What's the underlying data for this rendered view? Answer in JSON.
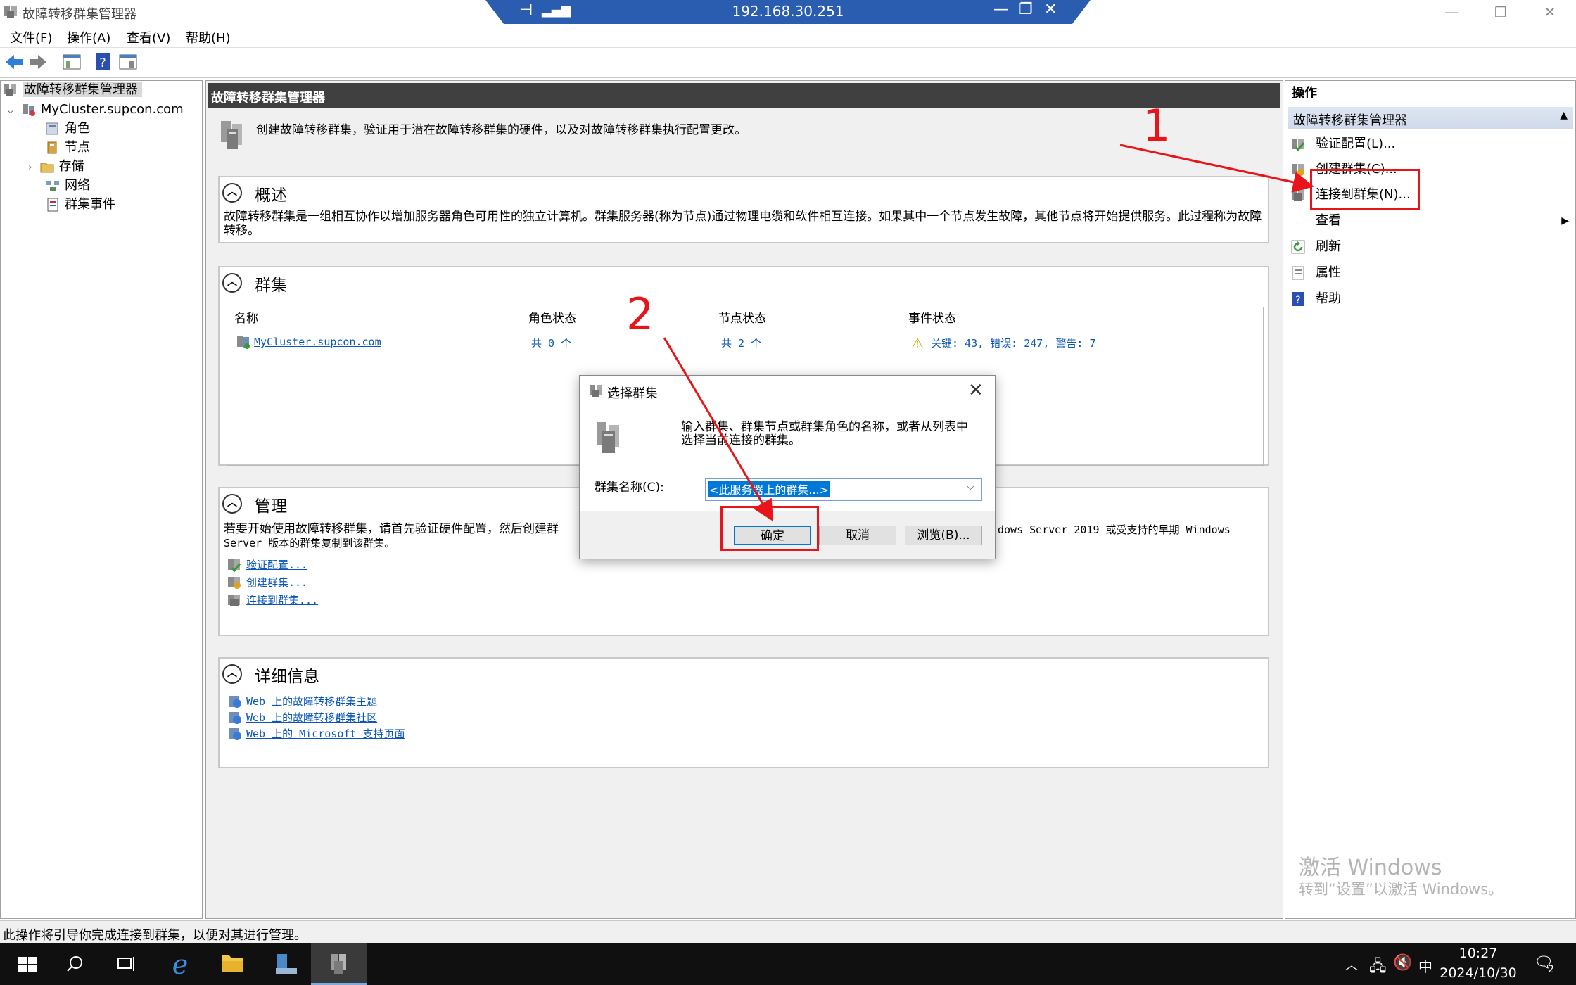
{
  "window": {
    "title": "故障转移群集管理器",
    "rdp_address": "192.168.30.251"
  },
  "menu": [
    "文件(F)",
    "操作(A)",
    "查看(V)",
    "帮助(H)"
  ],
  "tree": {
    "root": "故障转移群集管理器",
    "cluster": "MyCluster.supcon.com",
    "children": [
      "角色",
      "节点",
      "存储",
      "网络",
      "群集事件"
    ]
  },
  "center": {
    "header": "故障转移群集管理器",
    "intro": "创建故障转移群集，验证用于潜在故障转移群集的硬件，以及对故障转移群集执行配置更改。",
    "overview": {
      "title": "概述",
      "text": "故障转移群集是一组相互协作以增加服务器角色可用性的独立计算机。群集服务器(称为节点)通过物理电缆和软件相互连接。如果其中一个节点发生故障，其他节点将开始提供服务。此过程称为故障转移。"
    },
    "clusters": {
      "title": "群集",
      "columns": [
        "名称",
        "角色状态",
        "节点状态",
        "事件状态"
      ],
      "row": {
        "name": "MyCluster.supcon.com",
        "roles": "共 0 个",
        "nodes": "共 2 个",
        "events": "关键: 43, 错误: 247, 警告: 7"
      }
    },
    "management": {
      "title": "管理",
      "text_left": "若要开始使用故障转移群集，请首先验证硬件配置，然后创建群",
      "text_right": "dows Server 2019 或受支持的早期 Windows",
      "text_line2": "Server 版本的群集复制到该群集。",
      "links": [
        "验证配置...",
        "创建群集...",
        "连接到群集..."
      ]
    },
    "details": {
      "title": "详细信息",
      "links": [
        "Web 上的故障转移群集主题",
        "Web 上的故障转移群集社区",
        "Web 上的 Microsoft 支持页面"
      ]
    }
  },
  "actions": {
    "title": "操作",
    "group": "故障转移群集管理器",
    "items": [
      "验证配置(L)...",
      "创建群集(C)...",
      "连接到群集(N)...",
      "查看",
      "刷新",
      "属性",
      "帮助"
    ]
  },
  "watermark": {
    "line1": "激活 Windows",
    "line2": "转到“设置”以激活 Windows。"
  },
  "status": "此操作将引导你完成连接到群集，以便对其进行管理。",
  "dialog": {
    "title": "选择群集",
    "description": "输入群集、群集节点或群集角色的名称，或者从列表中选择当前连接的群集。",
    "label": "群集名称(C):",
    "value": "<此服务器上的群集...>",
    "ok": "确定",
    "cancel": "取消",
    "browse": "浏览(B)..."
  },
  "annotations": [
    "1",
    "2"
  ],
  "taskbar": {
    "time": "10:27",
    "date": "2024/10/30",
    "ime": "中",
    "notifications": "2"
  },
  "colors": {
    "accent": "#0078d7",
    "annotation": "#e8141a",
    "link": "#0b57b8"
  }
}
